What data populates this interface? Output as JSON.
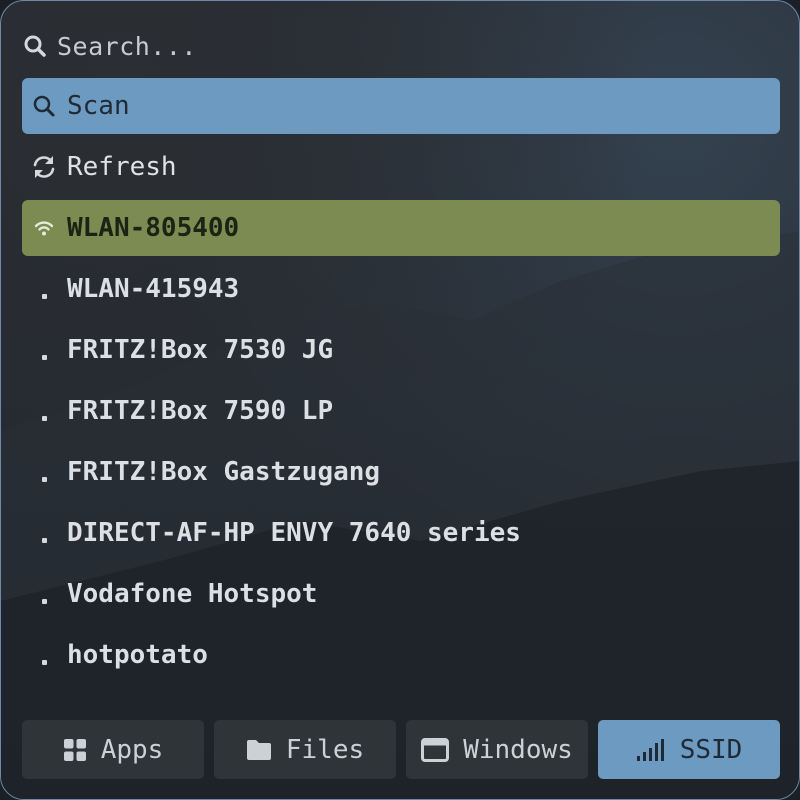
{
  "search": {
    "placeholder": "Search...",
    "icon": "search-icon"
  },
  "items": [
    {
      "label": "Scan",
      "icon": "search-icon",
      "state": "highlighted"
    },
    {
      "label": "Refresh",
      "icon": "refresh-icon"
    },
    {
      "label": "WLAN-805400",
      "icon": "wifi-icon",
      "state": "selected"
    },
    {
      "label": "WLAN-415943",
      "icon": "dot"
    },
    {
      "label": "FRITZ!Box 7530 JG",
      "icon": "dot"
    },
    {
      "label": "FRITZ!Box 7590 LP",
      "icon": "dot"
    },
    {
      "label": "FRITZ!Box Gastzugang",
      "icon": "dot"
    },
    {
      "label": "DIRECT-AF-HP ENVY 7640 series",
      "icon": "dot"
    },
    {
      "label": "Vodafone Hotspot",
      "icon": "dot"
    },
    {
      "label": "hotpotato",
      "icon": "dot"
    }
  ],
  "tabs": [
    {
      "label": "Apps",
      "icon": "grid-icon"
    },
    {
      "label": "Files",
      "icon": "folder-icon"
    },
    {
      "label": "Windows",
      "icon": "window-icon"
    },
    {
      "label": "SSID",
      "icon": "signal-icon",
      "selected": true
    }
  ],
  "colors": {
    "highlight_blue": "#6c9ac0",
    "selected_green": "#7b8b52",
    "tab_bg": "#2f3439"
  }
}
